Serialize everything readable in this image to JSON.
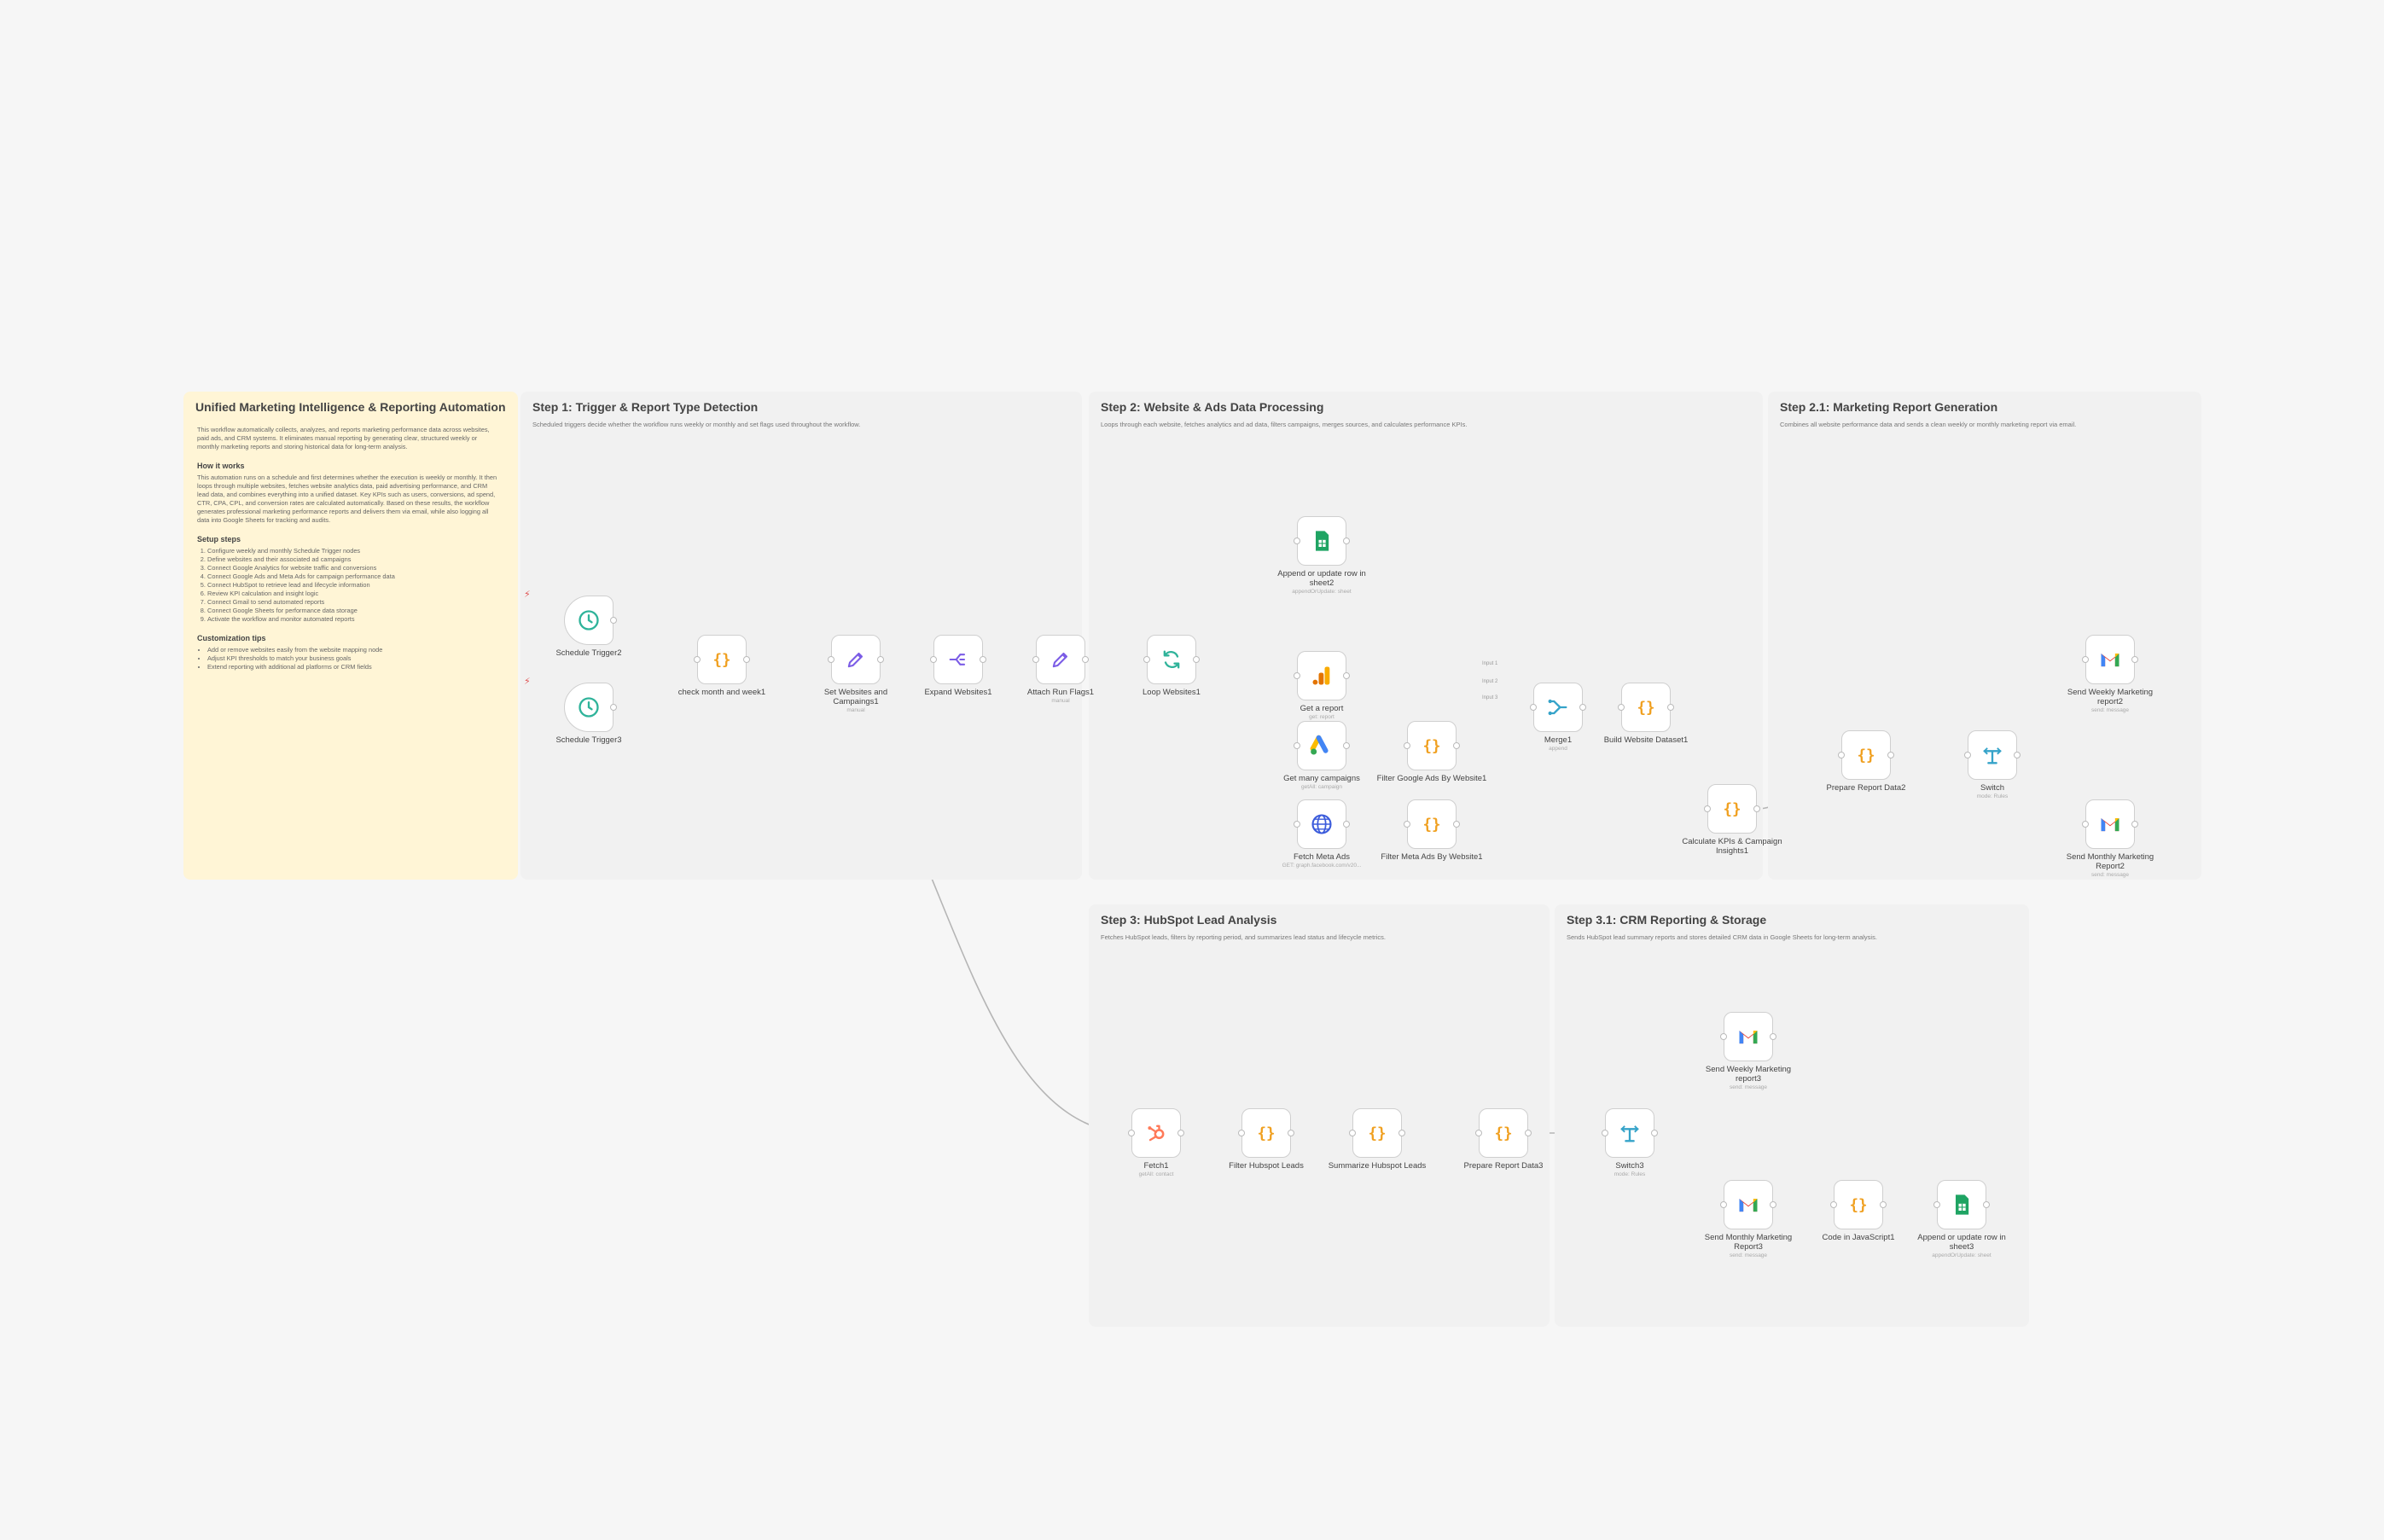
{
  "note": {
    "title": "Unified Marketing Intelligence & Reporting Automation",
    "intro": "This workflow automatically collects, analyzes, and reports marketing performance data across websites, paid ads, and CRM systems. It eliminates manual reporting by generating clear, structured weekly or monthly marketing reports and storing historical data for long-term analysis.",
    "how_title": "How it works",
    "how_text": "This automation runs on a schedule and first determines whether the execution is weekly or monthly. It then loops through multiple websites, fetches website analytics data, paid advertising performance, and CRM lead data, and combines everything into a unified dataset. Key KPIs such as users, conversions, ad spend, CTR, CPA, CPL, and conversion rates are calculated automatically. Based on these results, the workflow generates professional marketing performance reports and delivers them via email, while also logging all data into Google Sheets for tracking and audits.",
    "setup_title": "Setup steps",
    "setup_steps": [
      "Configure weekly and monthly Schedule Trigger nodes",
      "Define websites and their associated ad campaigns",
      "Connect Google Analytics for website traffic and conversions",
      "Connect Google Ads and Meta Ads for campaign performance data",
      "Connect HubSpot to retrieve lead and lifecycle information",
      "Review KPI calculation and insight logic",
      "Connect Gmail to send automated reports",
      "Connect Google Sheets for performance data storage",
      "Activate the workflow and monitor automated reports"
    ],
    "tips_title": "Customization tips",
    "tips": [
      "Add or remove websites easily from the website mapping node",
      "Adjust KPI thresholds to match your business goals",
      "Extend reporting with additional ad platforms or CRM fields"
    ]
  },
  "groups": [
    {
      "title": "Step 1: Trigger & Report Type Detection",
      "subtitle": "Scheduled triggers decide whether the workflow runs weekly or monthly and set flags used throughout the workflow."
    },
    {
      "title": "Step 2: Website & Ads Data Processing",
      "subtitle": "Loops through each website, fetches analytics and ad data, filters campaigns, merges sources, and calculates performance KPIs."
    },
    {
      "title": "Step 2.1: Marketing Report Generation",
      "subtitle": "Combines all website performance data and sends a clean weekly or monthly marketing report via email."
    },
    {
      "title": "Step 3: HubSpot Lead Analysis",
      "subtitle": "Fetches HubSpot leads, filters by reporting period, and summarizes lead status and lifecycle metrics."
    },
    {
      "title": "Step 3.1: CRM Reporting & Storage",
      "subtitle": "Sends HubSpot lead summary reports and stores detailed CRM data in Google Sheets for long-term analysis."
    }
  ],
  "nodes": {
    "schedule_trigger2": {
      "label": "Schedule Trigger2",
      "sub": "",
      "icon": "clock-icon"
    },
    "schedule_trigger3": {
      "label": "Schedule Trigger3",
      "sub": "",
      "icon": "clock-icon"
    },
    "check_month_week": {
      "label": "check month and week1",
      "sub": "",
      "icon": "code-icon"
    },
    "set_websites": {
      "label": "Set Websites and Campaings1",
      "sub": "manual",
      "icon": "pencil-icon"
    },
    "expand_websites": {
      "label": "Expand Websites1",
      "sub": "",
      "icon": "split-icon"
    },
    "attach_run_flags": {
      "label": "Attach Run Flags1",
      "sub": "manual",
      "icon": "pencil-icon"
    },
    "loop_websites": {
      "label": "Loop Websites1",
      "sub": "",
      "icon": "loop-icon"
    },
    "append_sheet2": {
      "label": "Append or update row in sheet2",
      "sub": "appendOrUpdate: sheet",
      "icon": "sheets-icon"
    },
    "get_report": {
      "label": "Get a report",
      "sub": "get: report",
      "icon": "analytics-icon"
    },
    "get_campaigns": {
      "label": "Get many campaigns",
      "sub": "getAll: campaign",
      "icon": "google-ads-icon"
    },
    "fetch_meta_ads": {
      "label": "Fetch Meta Ads",
      "sub": "GET: graph.facebook.com/v20...",
      "icon": "globe-icon"
    },
    "filter_google_ads": {
      "label": "Filter Google Ads By Website1",
      "sub": "",
      "icon": "code-icon"
    },
    "filter_meta_ads": {
      "label": "Filter Meta Ads By Website1",
      "sub": "",
      "icon": "code-icon"
    },
    "merge1": {
      "label": "Merge1",
      "sub": "append",
      "icon": "merge-icon"
    },
    "build_dataset": {
      "label": "Build Website Dataset1",
      "sub": "",
      "icon": "code-icon"
    },
    "calculate_kpis": {
      "label": "Calculate KPIs & Campaign Insights1",
      "sub": "",
      "icon": "code-icon"
    },
    "prepare_report2": {
      "label": "Prepare Report Data2",
      "sub": "",
      "icon": "code-icon"
    },
    "switch": {
      "label": "Switch",
      "sub": "mode: Rules",
      "icon": "switch-icon"
    },
    "send_weekly2": {
      "label": "Send Weekly Marketing report2",
      "sub": "send: message",
      "icon": "gmail-icon"
    },
    "send_monthly2": {
      "label": "Send Monthly Marketing Report2",
      "sub": "send: message",
      "icon": "gmail-icon"
    },
    "fetch1": {
      "label": "Fetch1",
      "sub": "getAll: contact",
      "icon": "hubspot-icon"
    },
    "filter_hubspot": {
      "label": "Filter Hubspot Leads",
      "sub": "",
      "icon": "code-icon"
    },
    "summarize_hubspot": {
      "label": "Summarize Hubspot Leads",
      "sub": "",
      "icon": "code-icon"
    },
    "prepare_report3": {
      "label": "Prepare Report Data3",
      "sub": "",
      "icon": "code-icon"
    },
    "switch3": {
      "label": "Switch3",
      "sub": "mode: Rules",
      "icon": "switch-icon"
    },
    "send_weekly3": {
      "label": "Send Weekly Marketing report3",
      "sub": "send: message",
      "icon": "gmail-icon"
    },
    "send_monthly3": {
      "label": "Send Monthly Marketing Report3",
      "sub": "send: message",
      "icon": "gmail-icon"
    },
    "code_js1": {
      "label": "Code in JavaScript1",
      "sub": "",
      "icon": "code-icon"
    },
    "append_sheet3": {
      "label": "Append or update row in sheet3",
      "sub": "appendOrUpdate: sheet",
      "icon": "sheets-icon"
    }
  },
  "merge_inputs": [
    "Input 1",
    "Input 2",
    "Input 3"
  ],
  "colors": {
    "code": "#f0a020",
    "pencil": "#7b5ce6",
    "trigger": "#2fb39a",
    "loop": "#2fb39a",
    "sheets": "#1fa463",
    "analytics": "#f9ab00",
    "globe": "#3b5bdb",
    "merge": "#35a3c9",
    "switch": "#35a3c9",
    "hubspot": "#ff7a59",
    "edge": "#b5b5b5",
    "note_bg": "#fff5d6"
  }
}
